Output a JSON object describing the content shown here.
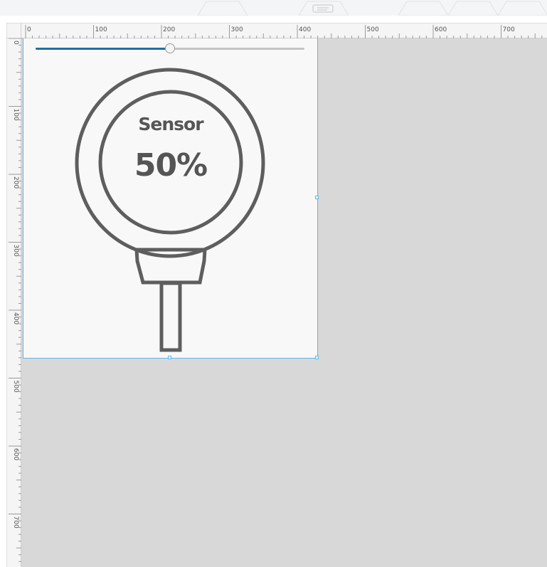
{
  "ruler": {
    "horizontal_labels": [
      "0",
      "100",
      "200",
      "300",
      "400",
      "500",
      "600",
      "700"
    ],
    "vertical_labels": [
      "0",
      "100",
      "200",
      "300",
      "400",
      "500",
      "600",
      "700"
    ]
  },
  "widget": {
    "title": "Sensor",
    "value_text": "50%",
    "slider_value": 0.5
  },
  "colors": {
    "canvas": "#d8d8d8",
    "artboard": "#f8f8f8",
    "selection": "#5bb8ea",
    "slider_fill": "#1f6fa8",
    "gauge_stroke": "#5e5e5e",
    "text": "#555555"
  }
}
